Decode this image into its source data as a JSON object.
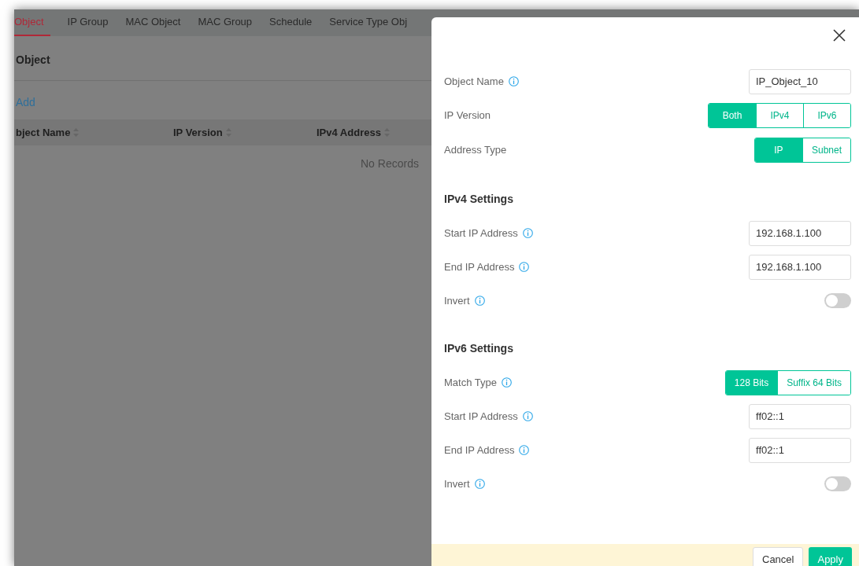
{
  "background_page": {
    "tabs": [
      {
        "label": "Object",
        "selected": true
      },
      {
        "label": "IP Group",
        "selected": false
      },
      {
        "label": "MAC Object",
        "selected": false
      },
      {
        "label": "MAC Group",
        "selected": false
      },
      {
        "label": "Schedule",
        "selected": false
      },
      {
        "label": "Service Type Obj",
        "selected": false
      }
    ],
    "heading": "Object",
    "add_link": "Add",
    "columns": [
      "bject Name",
      "IP Version",
      "IPv4 Address"
    ],
    "empty_text": "No Records"
  },
  "dialog": {
    "rows": [
      {
        "kind": "text",
        "label": "Object Name",
        "info": true,
        "value": "IP_Object_10"
      },
      {
        "kind": "segmented",
        "label": "IP Version",
        "info": false,
        "options": [
          {
            "label": "Both",
            "selected": true
          },
          {
            "label": "IPv4",
            "selected": false
          },
          {
            "label": "IPv6",
            "selected": false
          }
        ]
      },
      {
        "kind": "segmented",
        "label": "Address Type",
        "info": false,
        "options": [
          {
            "label": "IP",
            "selected": true
          },
          {
            "label": "Subnet",
            "selected": false
          }
        ]
      },
      {
        "kind": "section",
        "label": "IPv4 Settings"
      },
      {
        "kind": "text",
        "label": "Start IP Address",
        "info": true,
        "value": "192.168.1.100"
      },
      {
        "kind": "text",
        "label": "End IP Address",
        "info": true,
        "value": "192.168.1.100"
      },
      {
        "kind": "toggle",
        "label": "Invert",
        "info": true,
        "on": false
      },
      {
        "kind": "section",
        "label": "IPv6 Settings"
      },
      {
        "kind": "segmented",
        "label": "Match Type",
        "info": true,
        "options": [
          {
            "label": "128 Bits",
            "selected": true
          },
          {
            "label": "Suffix 64 Bits",
            "selected": false
          }
        ]
      },
      {
        "kind": "text",
        "label": "Start IP Address",
        "info": true,
        "value": "ff02::1"
      },
      {
        "kind": "text",
        "label": "End IP Address",
        "info": true,
        "value": "ff02::1"
      },
      {
        "kind": "toggle",
        "label": "Invert",
        "info": true,
        "on": false
      }
    ],
    "buttons": [
      {
        "label": "Cancel",
        "kind": "secondary"
      },
      {
        "label": "Apply",
        "kind": "primary"
      }
    ]
  }
}
